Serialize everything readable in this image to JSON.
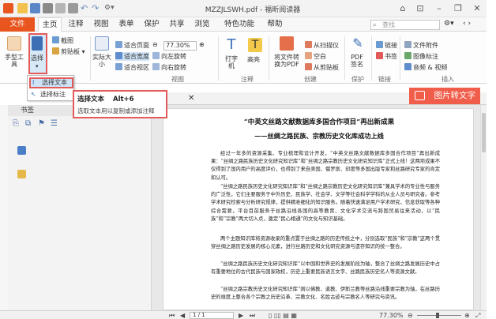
{
  "window": {
    "title": "MZZJLSWH.pdf - 福昕阅读器",
    "controls": [
      "min-icon",
      "restore-icon",
      "close-icon"
    ]
  },
  "menu": {
    "file": "文件",
    "tabs": [
      "主页",
      "注释",
      "视图",
      "表单",
      "保护",
      "共享",
      "浏览",
      "特色功能",
      "帮助"
    ],
    "active": "主页",
    "search_placeholder": "查找"
  },
  "ribbon": {
    "tools_group": {
      "hand": "手型工具",
      "select": "选择",
      "screenshot": "截图",
      "clipboard": "剪贴板"
    },
    "view_group": {
      "actual_size": "实际大小",
      "fit_page": "适合页面",
      "fit_width": "适合宽度",
      "fit_visible": "适合视区",
      "rotate_left": "向左旋转",
      "rotate_right": "向右旋转",
      "zoom": "77.30%",
      "label": "视图"
    },
    "comment_group": {
      "typewriter": "打字机",
      "highlight": "高亮",
      "label": "注释"
    },
    "create_group": {
      "convert": "将文件转换为PDF",
      "from_scanner": "从扫描仪",
      "blank": "空白",
      "from_clipboard": "从剪贴板",
      "label": "创建"
    },
    "protect_group": {
      "pdf_sign": "PDF签名",
      "label": "保护"
    },
    "link_group": {
      "link": "链接",
      "bookmark": "书签",
      "label": "链接"
    },
    "insert_group": {
      "file_attachment": "文件附件",
      "image_annotation": "图像标注",
      "audio_video": "音频 & 视频",
      "label": "插入"
    }
  },
  "dropdown": {
    "items": [
      "选择文本",
      "选择标注"
    ]
  },
  "tooltip": {
    "title": "选择文本",
    "shortcut": "Alt+6",
    "description": "选取文本用以复制或添加注释"
  },
  "image_to_text": "图片转文字",
  "bookmarks": {
    "header": "书签"
  },
  "document": {
    "title": "“中英文丝路文献数据库多国合作项目”再出新成果",
    "subtitle": "——丝绸之路民族、宗教历史文化库成功上线",
    "paragraphs": [
      "经过一年多的资源采集、专业梳理和设计开发，“中英文丝路文献数据库多国合作项目”再出新成果：“丝绸之路民族历史文化研究知识库”和“丝绸之路宗教历史文化研究知识库”正式上线！这两项成果不仅得到了国内用户的高度评价，也得到了来自美国、俄罗斯、印度等多国出版专家和丝路研究专家的肯定和认可。",
      "“丝绸之路民族历史文化研究知识库”和“丝绸之路宗教历史文化研究知识库”兼具学术的专业性与服务的广泛性，它们主要服务于中外历史、民族学、社会学、文学等社会科学学科的从业人员与研究者。参考学术研究检索与分析研究规律，提供精准细化的知识服务。随着快速满足用户学术研究、信息获取等各种综合需要，平台目前服务于丝路沿线各国的高等教育、文化学术交流与跨国贸易往来活动，以“民族”和“宗教”两大切入点，奠定“民心相通”的文化与知识基础。",
      "两个主题知识库将资源收录的重点置于丝绸之路的历史传统之中，分别选取“民族”和“宗教”这两个贯穿丝绸之路历史发展的核心元素，进行丝路历史和文化研究资源与遗存知识的统一整合。",
      "“丝绸之路民族历史文化研究知识库”以中国和世界史的发展阶段为轴，整合了丝绸之路发展历史中占有重要地位的古代民族与国家政权，历史上重要民族语言文字、丝路民族历史名人等资源文献。",
      "“丝绸之路宗教历史文化研究知识库”则以佛教、道教、伊斯兰教等丝路沿线重要宗教为轴，在丝路历史的维度上整合各个宗教之历史沿革、宗教文化、名胜古迹与宗教名人等研究与资讯。"
    ]
  },
  "status": {
    "page": "1 / 1",
    "zoom": "77.30%"
  },
  "colors": {
    "accent": "#e8551f",
    "highlight_border": "#e35a5a",
    "image_to_text_bg": "#f05e4b"
  }
}
